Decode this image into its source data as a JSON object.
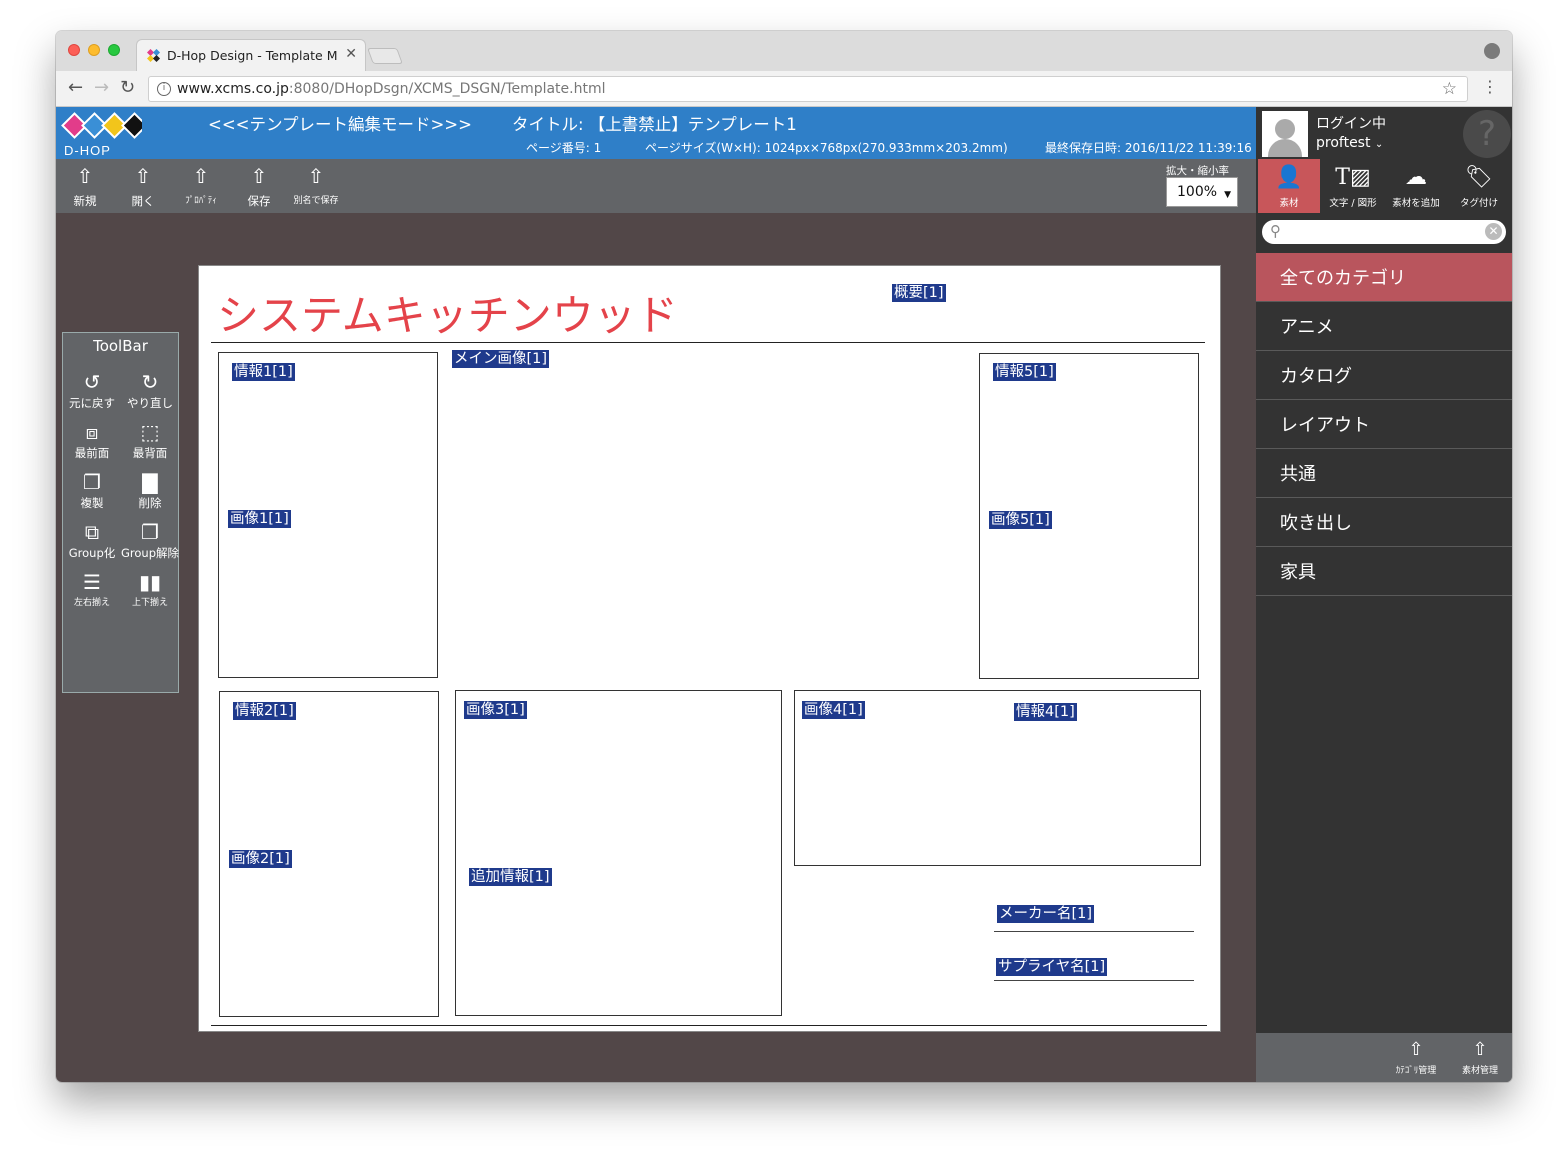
{
  "browser": {
    "tab_title": "D-Hop Design - Template Mod",
    "url_host": "www.xcms.co.jp",
    "url_path": ":8080/DHopDsgn/XCMS_DSGN/Template.html"
  },
  "header": {
    "logo_text": "D-HOP",
    "mode_title": "<<<テンプレート編集モード>>>",
    "page_title": "タイトル: 【上書禁止】テンプレート1",
    "page_number": "ページ番号: 1",
    "page_size": "ページサイズ(W×H): 1024px×768px(270.933mm×203.2mm)",
    "last_saved": "最終保存日時: 2016/11/22 11:39:16"
  },
  "top_toolbar": {
    "buttons": [
      {
        "label": "新規",
        "icon": "upload-arrow-icon"
      },
      {
        "label": "開く",
        "icon": "upload-arrow-icon"
      },
      {
        "label": "ﾌﾟﾛﾊﾟﾃｨ",
        "icon": "upload-arrow-icon"
      },
      {
        "label": "保存",
        "icon": "upload-arrow-icon"
      },
      {
        "label": "別名で保存",
        "icon": "upload-arrow-icon"
      }
    ],
    "zoom_label": "拡大・縮小率",
    "zoom_value": "100%"
  },
  "user_panel": {
    "status": "ログイン中",
    "username": "proftest",
    "help": "?"
  },
  "right_tabs": [
    {
      "label": "素材",
      "icon": "person-icon"
    },
    {
      "label": "文字 / 図形",
      "icon": "text-image-icon"
    },
    {
      "label": "素材を追加",
      "icon": "cloud-upload-icon"
    },
    {
      "label": "タグ付け",
      "icon": "tag-icon"
    }
  ],
  "search": {
    "placeholder": ""
  },
  "categories": [
    "全てのカテゴリ",
    "アニメ",
    "カタログ",
    "レイアウト",
    "共通",
    "吹き出し",
    "家具"
  ],
  "right_footer": [
    {
      "label": "ｶﾃｺﾞﾘ管理",
      "icon": "upload-arrow-icon"
    },
    {
      "label": "素材管理",
      "icon": "upload-arrow-icon"
    }
  ],
  "toolbox": {
    "title": "ToolBar",
    "tools": [
      {
        "label": "元に戻す",
        "icon": "undo-icon"
      },
      {
        "label": "やり直し",
        "icon": "redo-icon"
      },
      {
        "label": "最前面",
        "icon": "bring-front-icon"
      },
      {
        "label": "最背面",
        "icon": "send-back-icon"
      },
      {
        "label": "複製",
        "icon": "duplicate-icon"
      },
      {
        "label": "削除",
        "icon": "trash-icon"
      },
      {
        "label": "Group化",
        "icon": "group-icon"
      },
      {
        "label": "Group解除",
        "icon": "ungroup-icon"
      },
      {
        "label": "左右揃え",
        "icon": "align-horizontal-icon"
      },
      {
        "label": "上下揃え",
        "icon": "align-vertical-icon"
      }
    ]
  },
  "canvas": {
    "title": "システムキッチンウッド",
    "tags": {
      "summary": "概要[1]",
      "main_image": "メイン画像[1]",
      "info1": "情報1[1]",
      "image1": "画像1[1]",
      "info5": "情報5[1]",
      "image5": "画像5[1]",
      "info2": "情報2[1]",
      "image2": "画像2[1]",
      "image3": "画像3[1]",
      "additional_info": "追加情報[1]",
      "image4": "画像4[1]",
      "info4": "情報4[1]",
      "maker": "メーカー名[1]",
      "supplier": "サプライヤ名[1]"
    }
  }
}
